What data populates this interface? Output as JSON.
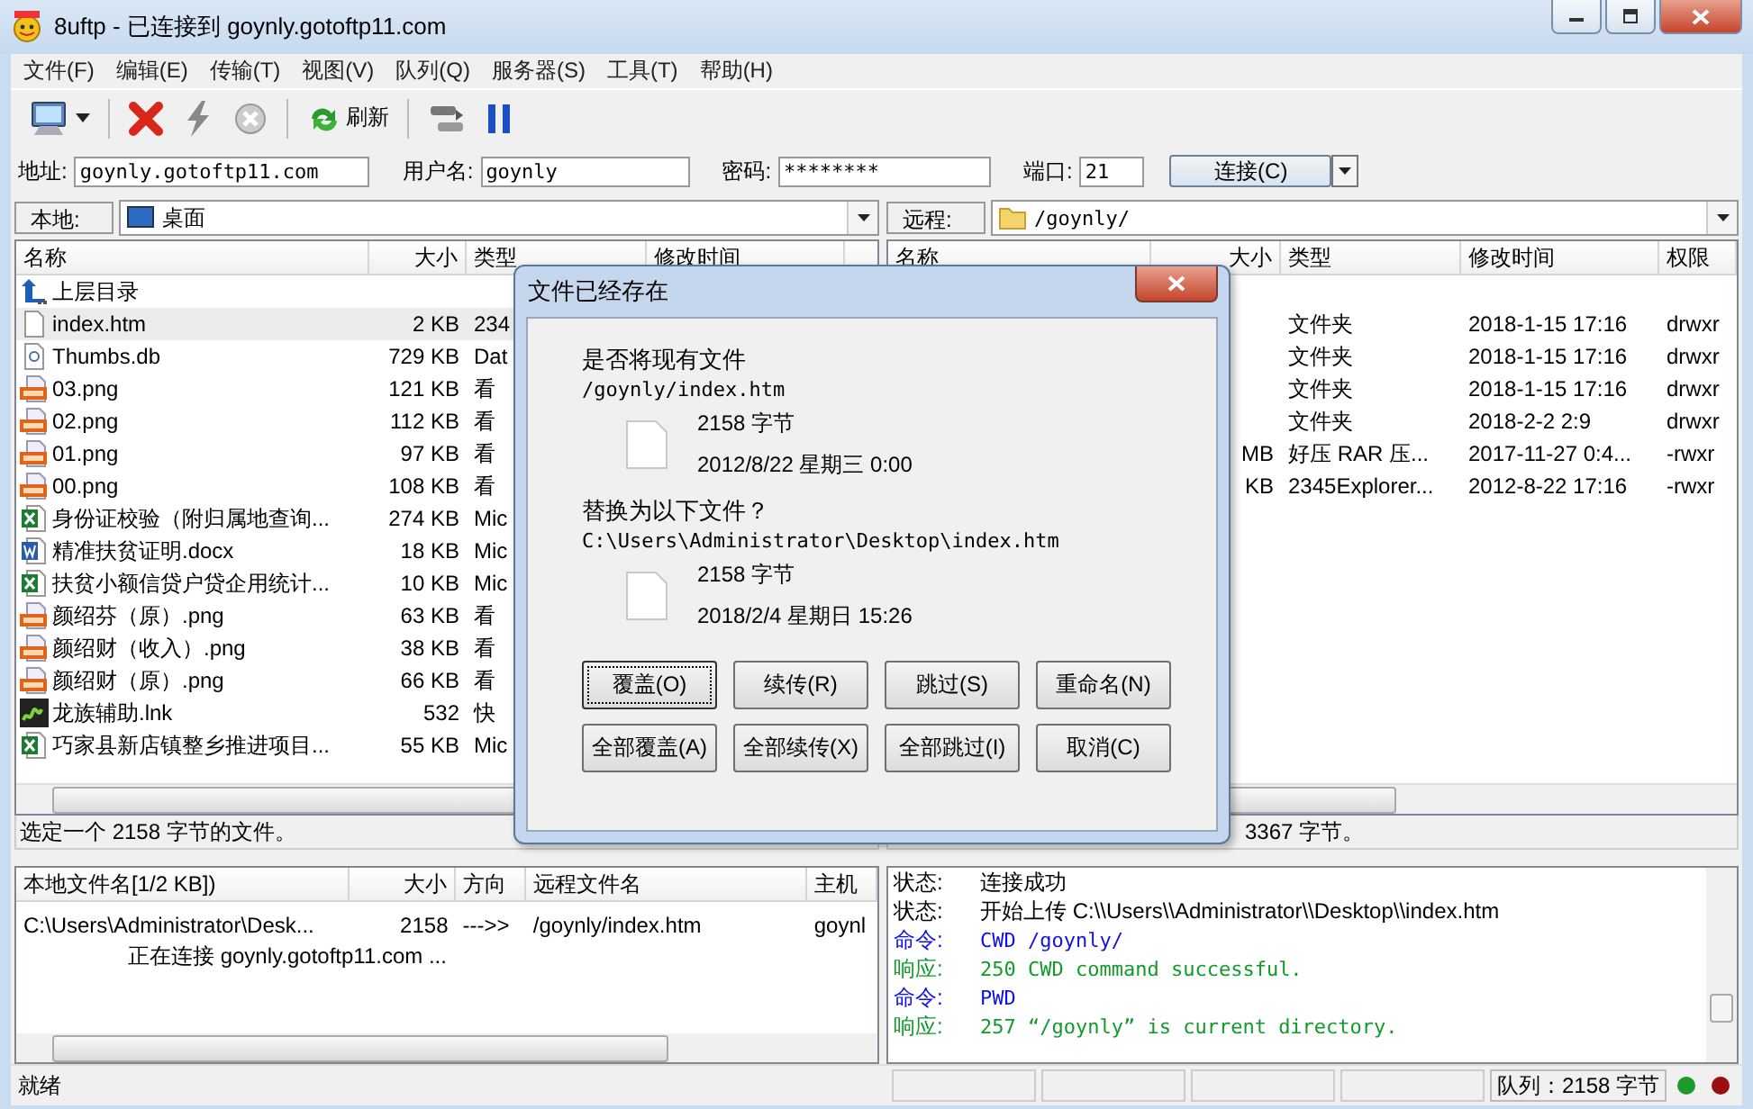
{
  "window": {
    "title": "8uftp - 已连接到 goynly.gotoftp11.com"
  },
  "menu": [
    "文件(F)",
    "编辑(E)",
    "传输(T)",
    "视图(V)",
    "队列(Q)",
    "服务器(S)",
    "工具(T)",
    "帮助(H)"
  ],
  "toolbar": {
    "refresh_label": "刷新"
  },
  "connection": {
    "address_label": "地址:",
    "address": "goynly.gotoftp11.com",
    "user_label": "用户名:",
    "user": "goynly",
    "password_label": "密码:",
    "password": "********",
    "port_label": "端口:",
    "port": "21",
    "connect_button": "连接(C)"
  },
  "panes": [
    {
      "location_label": "本地:",
      "location": "桌面",
      "columns": [
        "名称",
        "大小",
        "类型",
        "修改时间"
      ],
      "rows": [
        {
          "kind": "parent",
          "name": "上层目录",
          "selected": false
        },
        {
          "kind": "file",
          "name": "index.htm",
          "size": "2 KB",
          "type": "234",
          "selected": true
        },
        {
          "kind": "db",
          "name": "Thumbs.db",
          "size": "729 KB",
          "type": "Dat",
          "selected": false
        },
        {
          "kind": "png",
          "name": "03.png",
          "size": "121 KB",
          "type": "看",
          "selected": false
        },
        {
          "kind": "png",
          "name": "02.png",
          "size": "112 KB",
          "type": "看",
          "selected": false
        },
        {
          "kind": "png",
          "name": "01.png",
          "size": "97 KB",
          "type": "看",
          "selected": false
        },
        {
          "kind": "png",
          "name": "00.png",
          "size": "108 KB",
          "type": "看",
          "selected": false
        },
        {
          "kind": "excel",
          "name": "身份证校验（附归属地查询...",
          "size": "274 KB",
          "type": "Mic",
          "selected": false
        },
        {
          "kind": "word",
          "name": "精准扶贫证明.docx",
          "size": "18 KB",
          "type": "Mic",
          "selected": false
        },
        {
          "kind": "excel",
          "name": "扶贫小额信贷户贷企用统计...",
          "size": "10 KB",
          "type": "Mic",
          "selected": false
        },
        {
          "kind": "png",
          "name": "颜绍芬（原）.png",
          "size": "63 KB",
          "type": "看",
          "selected": false
        },
        {
          "kind": "png",
          "name": "颜绍财（收入）.png",
          "size": "38 KB",
          "type": "看",
          "selected": false
        },
        {
          "kind": "png",
          "name": "颜绍财（原）.png",
          "size": "66 KB",
          "type": "看",
          "selected": false
        },
        {
          "kind": "app",
          "name": "龙族辅助.lnk",
          "size": "532",
          "type": "快",
          "selected": false
        },
        {
          "kind": "excel",
          "name": "巧家县新店镇整乡推进项目...",
          "size": "55 KB",
          "type": "Mic",
          "selected": false
        }
      ],
      "status": "选定一个 2158 字节的文件。"
    },
    {
      "location_label": "远程:",
      "location": "/goynly/",
      "columns": [
        "名称",
        "大小",
        "类型",
        "修改时间",
        "权限"
      ],
      "rows": [
        {
          "type": "文件夹",
          "modified": "2018-1-15 17:16",
          "permissions": "drwxr",
          "selected": false
        },
        {
          "type": "文件夹",
          "modified": "2018-1-15 17:16",
          "permissions": "drwxr",
          "selected": false
        },
        {
          "type": "文件夹",
          "modified": "2018-1-15 17:16",
          "permissions": "drwxr",
          "selected": false
        },
        {
          "type": "文件夹",
          "modified": "2018-2-2 2:9",
          "permissions": "drwxr",
          "selected": false
        },
        {
          "size": "MB",
          "type": "好压 RAR 压...",
          "modified": "2017-11-27 0:4...",
          "permissions": "-rwxr",
          "selected": false
        },
        {
          "size": "KB",
          "type": "2345Explorer...",
          "modified": "2012-8-22 17:16",
          "permissions": "-rwxr",
          "selected": false
        }
      ],
      "status": "3367 字节。"
    }
  ],
  "queue": {
    "columns": [
      "本地文件名[1/2 KB])",
      "大小",
      "方向",
      "远程文件名",
      "主机"
    ],
    "rows": [
      {
        "local": "C:\\Users\\Administrator\\Desk...",
        "size": "2158",
        "direction": "--->>",
        "remote": "/goynly/index.htm",
        "host": "goynl"
      }
    ],
    "note": "正在连接 goynly.gotoftp11.com ..."
  },
  "log": [
    {
      "kind": "status",
      "label": "状态:",
      "text": "连接成功"
    },
    {
      "kind": "status",
      "label": "状态:",
      "text": "开始上传 C:\\\\Users\\\\Administrator\\\\Desktop\\\\index.htm"
    },
    {
      "kind": "command",
      "label": "命令:",
      "text": "CWD /goynly/"
    },
    {
      "kind": "response",
      "label": "响应:",
      "text": "250 CWD command successful."
    },
    {
      "kind": "command",
      "label": "命令:",
      "text": "PWD"
    },
    {
      "kind": "response",
      "label": "响应:",
      "text": "257 “/goynly” is current directory."
    }
  ],
  "status_bar": {
    "text": "就绪",
    "queue": "队列：2158 字节",
    "indicators": [
      {
        "color": "#1e9a2c"
      },
      {
        "color": "#9a1010"
      }
    ]
  },
  "dialog": {
    "title": "文件已经存在",
    "question": "是否将现有文件",
    "existing": {
      "path": "/goynly/index.htm",
      "size": "2158 字节",
      "date": "2012/8/22 星期三 0:00"
    },
    "replace_prompt": "替换为以下文件？",
    "replacement": {
      "path": "C:\\Users\\Administrator\\Desktop\\index.htm",
      "size": "2158 字节",
      "date": "2018/2/4 星期日 15:26"
    },
    "buttons": [
      {
        "label": "覆盖(O)",
        "default": true
      },
      {
        "label": "续传(R)",
        "default": false
      },
      {
        "label": "跳过(S)",
        "default": false
      },
      {
        "label": "重命名(N)",
        "default": false
      },
      {
        "label": "全部覆盖(A)",
        "default": false
      },
      {
        "label": "全部续传(X)",
        "default": false
      },
      {
        "label": "全部跳过(I)",
        "default": false
      },
      {
        "label": "取消(C)",
        "default": false
      }
    ]
  }
}
